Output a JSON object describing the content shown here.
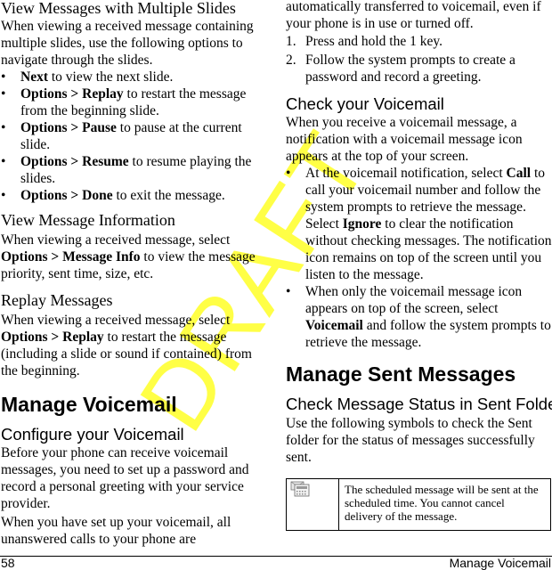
{
  "watermark": "DRAFT",
  "left_column": {
    "s1_title": "View Messages with Multiple Slides",
    "s1_intro": "When viewing a received message containing multiple slides, use the following options to navigate through the slides.",
    "s1_bullets": [
      {
        "bold": "Next",
        "text": " to view the next slide."
      },
      {
        "bold": "Options > Replay",
        "text": " to restart the message from the beginning slide."
      },
      {
        "bold": "Options > Pause",
        "text": " to pause at the current slide."
      },
      {
        "bold": "Options > Resume",
        "text": " to resume playing the slides."
      },
      {
        "bold": "Options > Done",
        "text": " to exit the message."
      }
    ],
    "s2_title": "View Message Information",
    "s2_text_pre": "When viewing a received message, select ",
    "s2_bold": "Options > Message Info",
    "s2_text_post": " to view the message priority, sent time, size, etc.",
    "s3_title": "Replay Messages",
    "s3_text_pre": "When viewing a received message, select ",
    "s3_bold": "Options > Replay",
    "s3_text_post": " to restart the message (including a slide or sound if contained) from the beginning.",
    "h1_voicemail": "Manage Voicemail",
    "h2_configure": "Configure your Voicemail",
    "configure_p1": "Before your phone can receive voicemail messages, you need to set up a password and record a personal greeting with your service provider.",
    "configure_p2": "When you have set up your voicemail, all unanswered calls to your phone are"
  },
  "right_column": {
    "continued": "automatically transferred to voicemail, even if your phone is in use or turned off.",
    "steps": [
      {
        "num": "1.",
        "text": "Press and hold the 1 key."
      },
      {
        "num": "2.",
        "text": "Follow the system prompts to create a password and record a greeting."
      }
    ],
    "h2_check": "Check your Voicemail",
    "check_intro": "When you receive a voicemail message, a notification with a voicemail message icon appears at the top of your screen.",
    "check_b1_pre": "At the voicemail notification, select ",
    "check_b1_bold1": "Call",
    "check_b1_mid": " to call your voicemail number and follow the system prompts to retrieve the message. Select ",
    "check_b1_bold2": "Ignore",
    "check_b1_post": " to clear the notification without checking messages. The notification icon remains on top of the screen until you listen to the message.",
    "check_b2_pre": "When only the voicemail message icon appears on top of the screen, select ",
    "check_b2_bold": "Voicemail",
    "check_b2_post": " and follow the system prompts to retrieve the message.",
    "h1_sent": "Manage Sent Messages",
    "h2_status": "Check Message Status in Sent Folder",
    "status_intro": "Use the following symbols to check the Sent folder for the status of messages successfully sent.",
    "table": [
      {
        "icon": "scheduled-message-icon",
        "description": "The scheduled message will be sent at the scheduled time. You cannot cancel delivery of the message."
      }
    ]
  },
  "footer": {
    "page_number": "58",
    "section": "Manage Voicemail"
  },
  "bullet_glyph": "•"
}
